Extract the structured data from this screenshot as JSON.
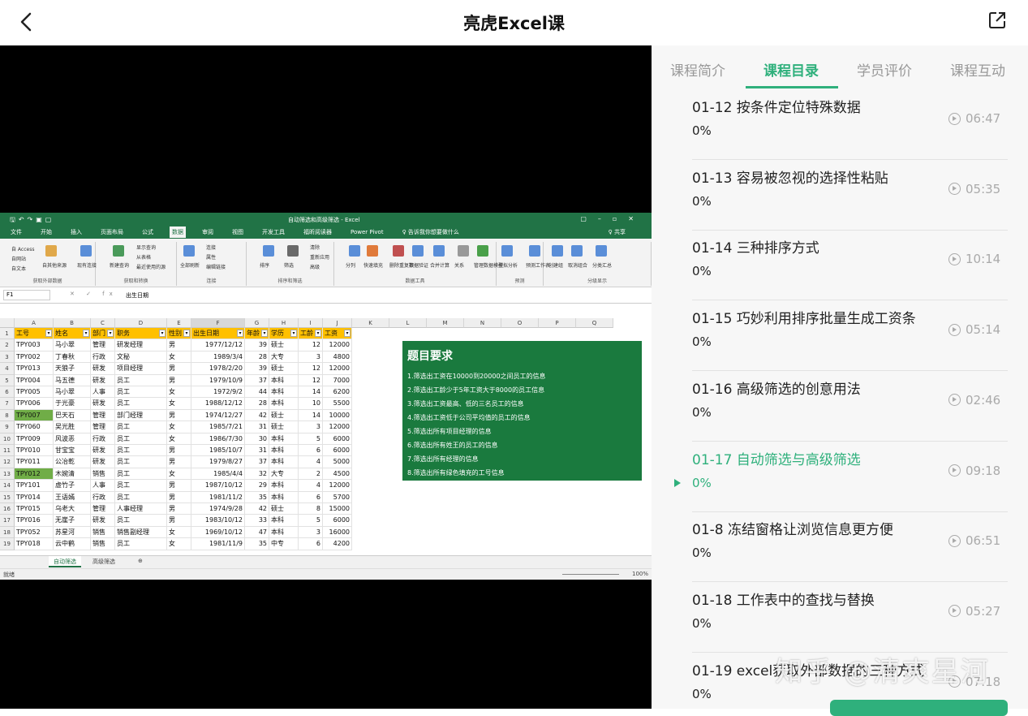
{
  "app": {
    "title": "亮虎Excel课"
  },
  "tabs": [
    "课程简介",
    "课程目录",
    "学员评价",
    "课程互动"
  ],
  "active_tab": "课程目录",
  "lessons": [
    {
      "title": "01-12 按条件定位特殊数据",
      "progress": "0%",
      "duration": "06:47"
    },
    {
      "title": "01-13 容易被忽视的选择性粘贴",
      "progress": "0%",
      "duration": "05:35"
    },
    {
      "title": "01-14 三种排序方式",
      "progress": "0%",
      "duration": "10:14"
    },
    {
      "title": "01-15 巧妙利用排序批量生成工资条",
      "progress": "0%",
      "duration": "05:14"
    },
    {
      "title": "01-16 高级筛选的创意用法",
      "progress": "0%",
      "duration": "02:46"
    },
    {
      "title": "01-17 自动筛选与高级筛选",
      "progress": "0%",
      "duration": "09:18",
      "current": true
    },
    {
      "title": "01-8 冻结窗格让浏览信息更方便",
      "progress": "0%",
      "duration": "06:51"
    },
    {
      "title": "01-18 工作表中的查找与替换",
      "progress": "0%",
      "duration": "05:27"
    },
    {
      "title": "01-19 excel获取外部数据的三种方式",
      "progress": "0%",
      "duration": "07:18"
    }
  ],
  "watermark": "知乎 @清爽星河",
  "colors": {
    "accent": "#2fb07c",
    "excel_green": "#217346",
    "header_yellow": "#ffc000",
    "highlight_green": "#70ad47"
  },
  "excel": {
    "window_title": "自动筛选和高级筛选 - Excel",
    "menu": [
      "文件",
      "开始",
      "插入",
      "页面布局",
      "公式",
      "数据",
      "审阅",
      "视图",
      "开发工具",
      "福昕阅读器",
      "Power Pivot",
      "♀ 告诉我你想要做什么"
    ],
    "active_menu": "数据",
    "user_label": "♀ 共享",
    "ribbon_groups": [
      "获取外部数据",
      "获取和转换",
      "连接",
      "排序和筛选",
      "数据工具",
      "预测",
      "分级显示"
    ],
    "ribbon_items": [
      "自 Access",
      "自网站",
      "自文本",
      "自其他来源",
      "现有连接",
      "新建查询",
      "显示查询",
      "从表格",
      "最近使用的源",
      "全部刷新",
      "连接",
      "属性",
      "编辑链接",
      "排序",
      "筛选",
      "清除",
      "重新应用",
      "高级",
      "分列",
      "快速填充",
      "删除重复项",
      "数据验证",
      "合并计算",
      "关系",
      "管理数据模型",
      "模拟分析",
      "预测工作表",
      "创建组",
      "取消组合",
      "分类汇总"
    ],
    "name_box": "F1",
    "formula_icons": "✕ ✓ fx",
    "formula": "出生日期",
    "columns": [
      "A",
      "B",
      "C",
      "D",
      "E",
      "F",
      "G",
      "H",
      "I",
      "J",
      "K",
      "L",
      "M",
      "N",
      "O",
      "P",
      "Q"
    ],
    "headers": [
      "工号",
      "姓名",
      "部门",
      "职务",
      "性别",
      "出生日期",
      "年龄",
      "学历",
      "工龄",
      "工资"
    ],
    "rows": [
      [
        "TPY003",
        "马小翠",
        "管理",
        "研发经理",
        "男",
        "1977/12/12",
        "39",
        "硕士",
        "12",
        "12000"
      ],
      [
        "TPY002",
        "丁春秋",
        "行政",
        "文秘",
        "女",
        "1989/3/4",
        "28",
        "大专",
        "3",
        "4800"
      ],
      [
        "TPY013",
        "天狼子",
        "研发",
        "项目经理",
        "男",
        "1978/2/20",
        "39",
        "硕士",
        "12",
        "12000"
      ],
      [
        "TPY004",
        "马五德",
        "研发",
        "员工",
        "男",
        "1979/10/9",
        "37",
        "本科",
        "12",
        "7000"
      ],
      [
        "TPY005",
        "马小翠",
        "人事",
        "员工",
        "女",
        "1972/9/2",
        "44",
        "本科",
        "14",
        "6200"
      ],
      [
        "TPY006",
        "于光豪",
        "研发",
        "员工",
        "女",
        "1988/12/12",
        "28",
        "本科",
        "10",
        "5500"
      ],
      [
        "TPY007",
        "巴天石",
        "管理",
        "部门经理",
        "男",
        "1974/12/27",
        "42",
        "硕士",
        "14",
        "10000"
      ],
      [
        "TPY060",
        "吴光胜",
        "管理",
        "员工",
        "女",
        "1985/7/21",
        "31",
        "硕士",
        "3",
        "12000"
      ],
      [
        "TPY009",
        "风波恶",
        "行政",
        "员工",
        "女",
        "1986/7/30",
        "30",
        "本科",
        "5",
        "6000"
      ],
      [
        "TPY010",
        "甘宝宝",
        "研发",
        "员工",
        "男",
        "1985/10/7",
        "31",
        "本科",
        "6",
        "6000"
      ],
      [
        "TPY011",
        "公冶乾",
        "研发",
        "员工",
        "男",
        "1979/8/27",
        "37",
        "本科",
        "4",
        "5000"
      ],
      [
        "TPY012",
        "木婉清",
        "销售",
        "员工",
        "女",
        "1985/4/4",
        "32",
        "大专",
        "2",
        "4500"
      ],
      [
        "TPY101",
        "虚竹子",
        "人事",
        "员工",
        "男",
        "1987/10/12",
        "29",
        "本科",
        "4",
        "12000"
      ],
      [
        "TPY014",
        "王语嫣",
        "行政",
        "员工",
        "男",
        "1981/11/2",
        "35",
        "本科",
        "6",
        "5700"
      ],
      [
        "TPY015",
        "乌老大",
        "管理",
        "人事经理",
        "男",
        "1974/9/28",
        "42",
        "硕士",
        "8",
        "15000"
      ],
      [
        "TPY016",
        "无崖子",
        "研发",
        "员工",
        "男",
        "1983/10/12",
        "33",
        "本科",
        "5",
        "6000"
      ],
      [
        "TPY052",
        "苏星河",
        "销售",
        "销售副经理",
        "女",
        "1969/10/12",
        "47",
        "本科",
        "3",
        "16000"
      ],
      [
        "TPY018",
        "云中鹤",
        "销售",
        "员工",
        "女",
        "1981/11/9",
        "35",
        "中专",
        "6",
        "4200"
      ]
    ],
    "row_numbers": [
      "1",
      "2",
      "3",
      "4",
      "5",
      "6",
      "7",
      "8",
      "9",
      "10",
      "11",
      "12",
      "13",
      "14",
      "15",
      "16",
      "17",
      "18",
      "19"
    ],
    "highlighted_ids": [
      "TPY007",
      "TPY012"
    ],
    "requirements_title": "题目要求",
    "requirements": [
      "1.筛选出工资在10000到20000之间员工的信息",
      "2.筛选出工龄少于5年工资大于8000的员工信息",
      "3.筛选出工资最高、低的三名员工的信息",
      "4.筛选出工资低于公司平均值的员工的信息",
      "5.筛选出所有项目经理的信息",
      "6.筛选出所有姓王的员工的信息",
      "7.筛选出所有经理的信息",
      "8.筛选出所有绿色填充的工号信息"
    ],
    "sheet_tabs": [
      "自动筛选",
      "高级筛选"
    ],
    "active_sheet": "自动筛选",
    "status_left": "就绪",
    "zoom": "100%"
  }
}
